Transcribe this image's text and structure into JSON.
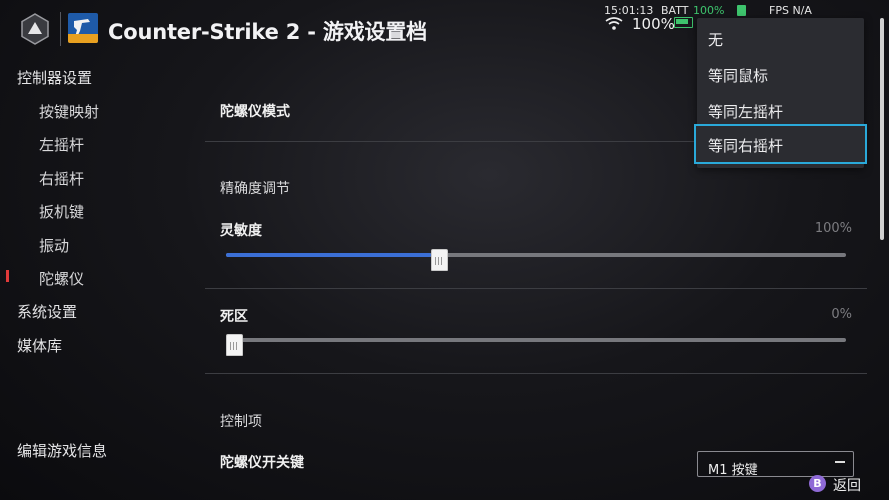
{
  "header": {
    "title": "Counter-Strike 2 - 游戏设置档",
    "logo_icon": "hexagon-logo-icon",
    "game_icon": "counter-strike-icon"
  },
  "status": {
    "time": "15:01:13",
    "batt_label": "BATT",
    "batt_pct": "100%",
    "fps": "FPS N/A",
    "volume_pct": "100%",
    "wifi_icon": "wifi-icon",
    "battery_icon": "battery-icon",
    "charge_icon": "plug-icon"
  },
  "sidebar": {
    "items": [
      {
        "label": "控制器设置"
      },
      {
        "label": "按键映射"
      },
      {
        "label": "左摇杆"
      },
      {
        "label": "右摇杆"
      },
      {
        "label": "扳机键"
      },
      {
        "label": "振动"
      },
      {
        "label": "陀螺仪"
      },
      {
        "label": "系统设置"
      },
      {
        "label": "媒体库"
      }
    ],
    "footer_label": "编辑游戏信息",
    "active_color": "#e03a3a"
  },
  "main": {
    "gyro_mode_label": "陀螺仪模式",
    "precision_label": "精确度调节",
    "sensitivity": {
      "label": "灵敏度",
      "value_text": "100%",
      "level": 0.33
    },
    "deadzone": {
      "label": "死区",
      "value_text": "0%",
      "level": 0.0
    },
    "controls_label": "控制项",
    "gyro_toggle": {
      "label": "陀螺仪开关键",
      "value": "M1 按键"
    },
    "accent_color": "#3b6fd6"
  },
  "dropdown": {
    "options": [
      {
        "label": "无"
      },
      {
        "label": "等同鼠标"
      },
      {
        "label": "等同左摇杆"
      },
      {
        "label": "等同右摇杆"
      }
    ],
    "selected_index": 3,
    "selected_outline_color": "#2aa9d9"
  },
  "footer": {
    "back_glyph": "B",
    "back_label": "返回",
    "back_icon_color": "#8f6ad6"
  }
}
